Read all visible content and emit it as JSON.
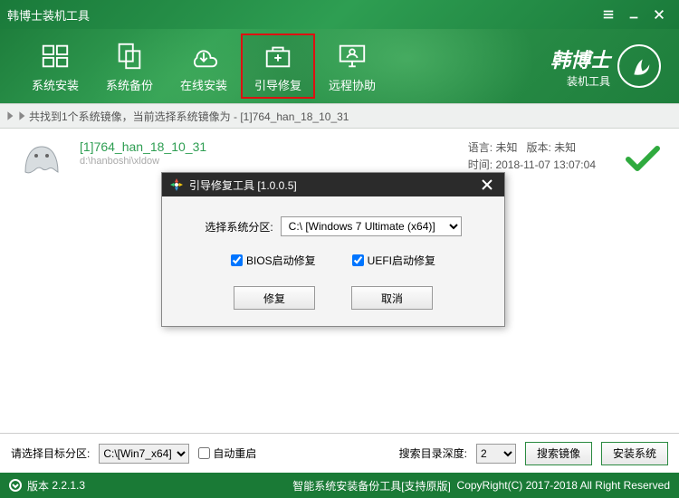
{
  "window": {
    "title": "韩博士装机工具"
  },
  "toolbar": {
    "items": [
      {
        "label": "系统安装"
      },
      {
        "label": "系统备份"
      },
      {
        "label": "在线安装"
      },
      {
        "label": "引导修复"
      },
      {
        "label": "远程协助"
      }
    ]
  },
  "brand": {
    "line1": "韩博士",
    "line2": "装机工具"
  },
  "crumb": {
    "text": "共找到1个系统镜像，当前选择系统镜像为 - [1]764_han_18_10_31"
  },
  "image": {
    "title": "[1]764_han_18_10_31",
    "path": "d:\\hanboshi\\xldow",
    "lang_label": "语言:",
    "lang_value": "未知",
    "ver_label": "版本:",
    "ver_value": "未知",
    "time_label": "时间:",
    "time_value": "2018-11-07 13:07:04"
  },
  "dialog": {
    "title": "引导修复工具 [1.0.0.5]",
    "partition_label": "选择系统分区:",
    "partition_value": "C:\\ [Windows 7 Ultimate (x64)]",
    "bios_label": "BIOS启动修复",
    "uefi_label": "UEFI启动修复",
    "repair_btn": "修复",
    "cancel_btn": "取消"
  },
  "bottom": {
    "target_label": "请选择目标分区:",
    "target_value": "C:\\[Win7_x64]",
    "auto_reboot": "自动重启",
    "depth_label": "搜索目录深度:",
    "depth_value": "2",
    "search_btn": "搜索镜像",
    "install_btn": "安装系统"
  },
  "status": {
    "version_label": "版本",
    "version": "2.2.1.3",
    "product": "智能系统安装备份工具[支持原版]",
    "copyright": "CopyRight(C) 2017-2018 All Right Reserved"
  }
}
